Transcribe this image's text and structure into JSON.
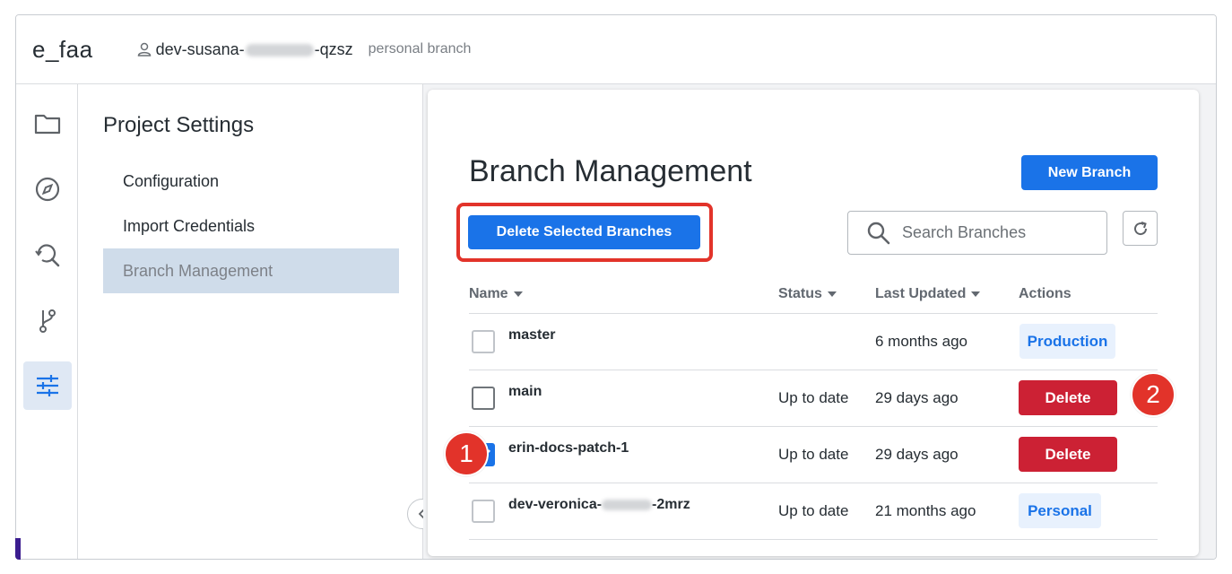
{
  "topbar": {
    "project_name": "e_faa",
    "user_prefix": "dev-susana-",
    "user_suffix": "-qzsz",
    "branch_label": "personal branch"
  },
  "icon_nav": [
    "folder-icon",
    "compass-icon",
    "search-history-icon",
    "branch-icon",
    "sliders-icon"
  ],
  "settings": {
    "title": "Project Settings",
    "items": [
      {
        "label": "Configuration"
      },
      {
        "label": "Import Credentials"
      },
      {
        "label": "Branch Management",
        "active": true
      }
    ]
  },
  "branch_management": {
    "title": "Branch Management",
    "new_branch_label": "New Branch",
    "delete_selected_label": "Delete Selected Branches",
    "search_placeholder": "Search Branches",
    "columns": [
      "Name",
      "Status",
      "Last Updated",
      "Actions"
    ],
    "rows": [
      {
        "name": "master",
        "status": "",
        "updated": "6 months ago",
        "action": "Production",
        "checked": false
      },
      {
        "name": "main",
        "status": "Up to date",
        "updated": "29 days ago",
        "action": "Delete",
        "checked": false
      },
      {
        "name": "erin-docs-patch-1",
        "status": "Up to date",
        "updated": "29 days ago",
        "action": "Delete",
        "checked": true
      },
      {
        "name_prefix": "dev-veronica-",
        "name_suffix": "-2mrz",
        "status": "Up to date",
        "updated": "21 months ago",
        "action": "Personal",
        "checked": false
      }
    ]
  },
  "callouts": [
    "1",
    "2"
  ],
  "colors": {
    "primary": "#1a73e8",
    "danger": "#cc2134",
    "highlight": "#e2332a",
    "tag_bg": "#e8f1fd"
  }
}
